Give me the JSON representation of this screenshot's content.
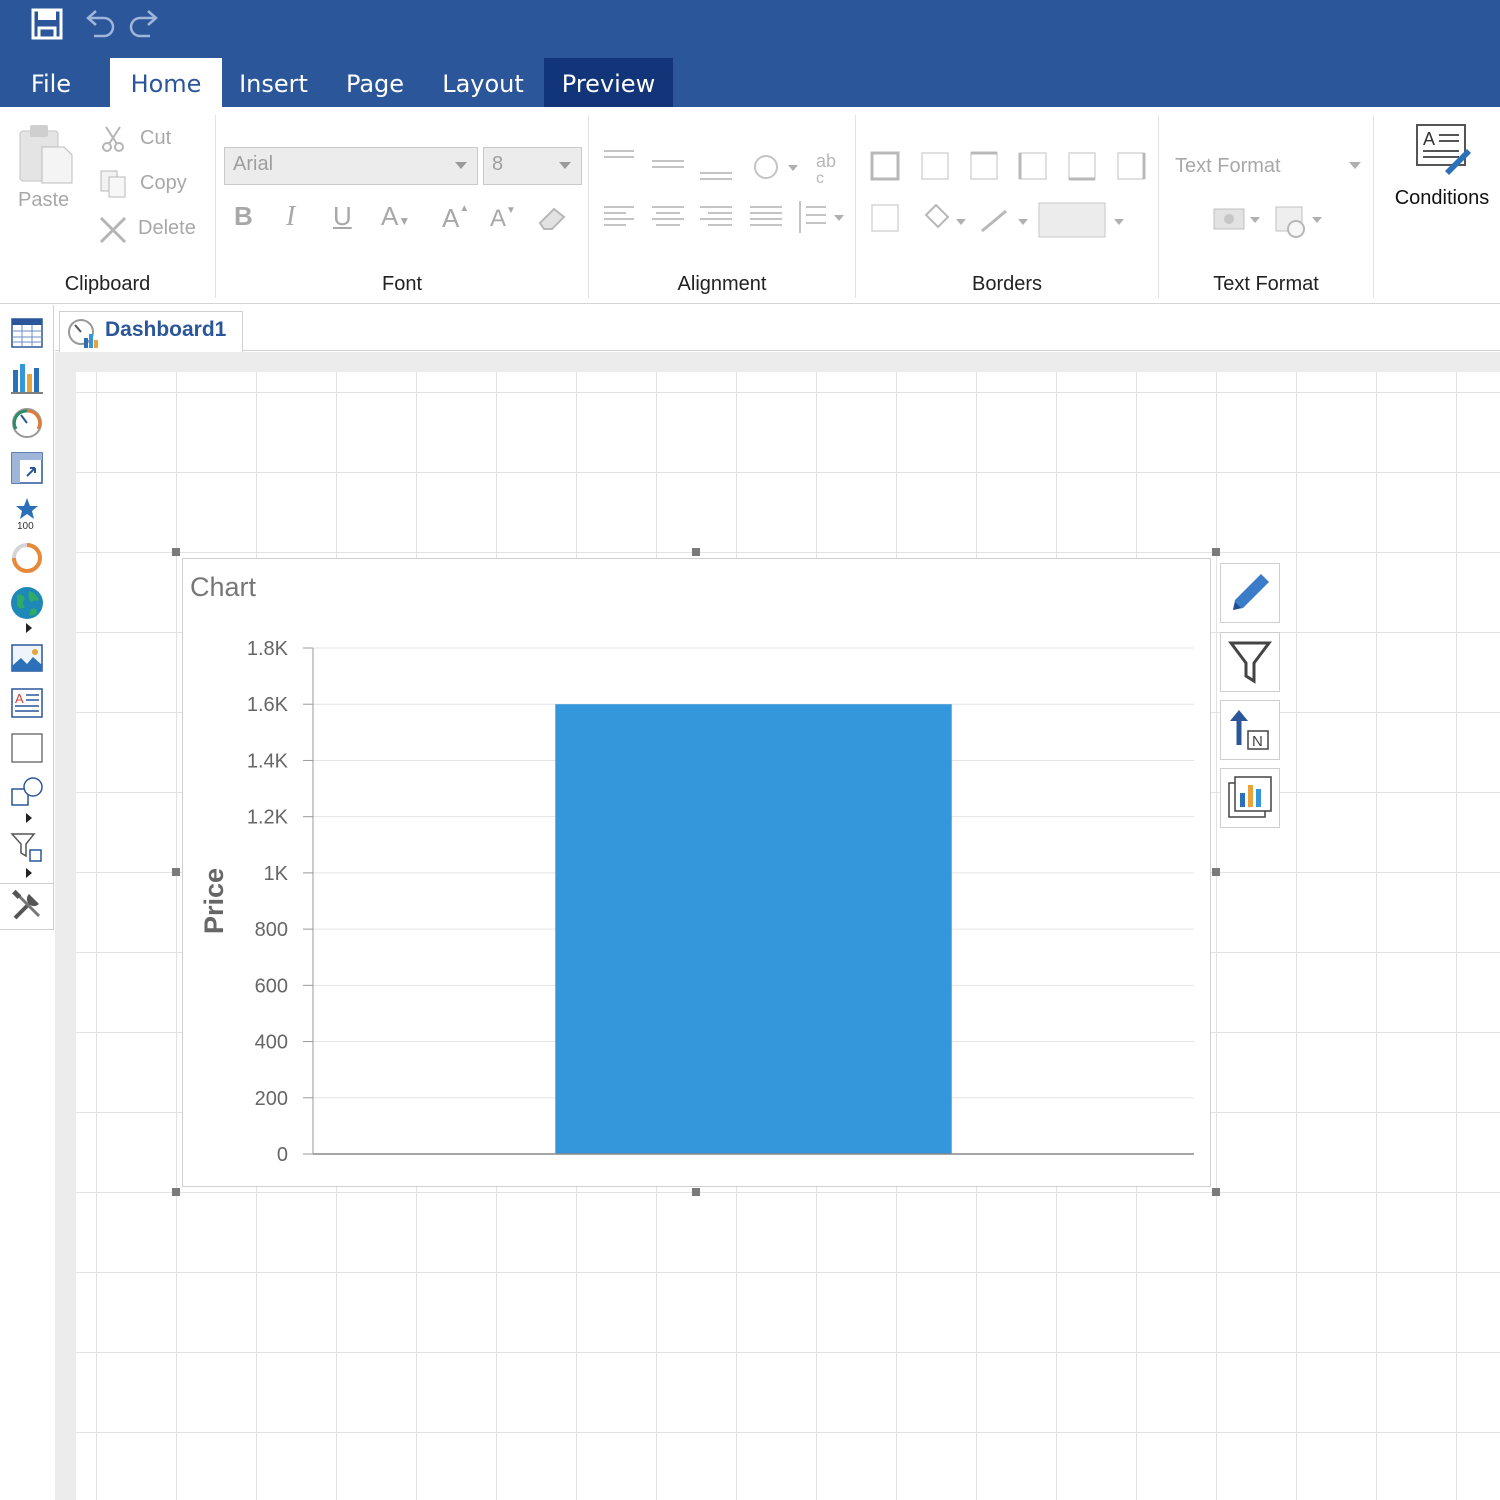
{
  "tabs": [
    "File",
    "Home",
    "Insert",
    "Page",
    "Layout",
    "Preview"
  ],
  "clipboard": {
    "paste": "Paste",
    "cut": "Cut",
    "copy": "Copy",
    "delete": "Delete",
    "label": "Clipboard"
  },
  "font": {
    "family": "Arial",
    "size": "8",
    "label": "Font"
  },
  "alignment": {
    "label": "Alignment"
  },
  "borders": {
    "label": "Borders"
  },
  "text_format": {
    "dropdown": "Text Format",
    "label": "Text Format"
  },
  "conditions": {
    "label": "Conditions"
  },
  "document": {
    "tab": "Dashboard1"
  },
  "chart_widget": {
    "title": "Chart"
  },
  "chart_data": {
    "type": "bar",
    "categories": [
      ""
    ],
    "values": [
      1600
    ],
    "ylabel": "Price",
    "xlabel": "",
    "ylim": [
      0,
      1800
    ],
    "yticks": [
      0,
      200,
      400,
      600,
      800,
      1000,
      1200,
      1400,
      1600,
      1800
    ],
    "ytick_labels": [
      "0",
      "200",
      "400",
      "600",
      "800",
      "1K",
      "1.2K",
      "1.4K",
      "1.6K",
      "1.8K"
    ],
    "bar_color": "#3497db",
    "grid": true
  },
  "colors": {
    "accent": "#2b579a",
    "active_tab_dark": "#12357a",
    "bar": "#3497db"
  }
}
